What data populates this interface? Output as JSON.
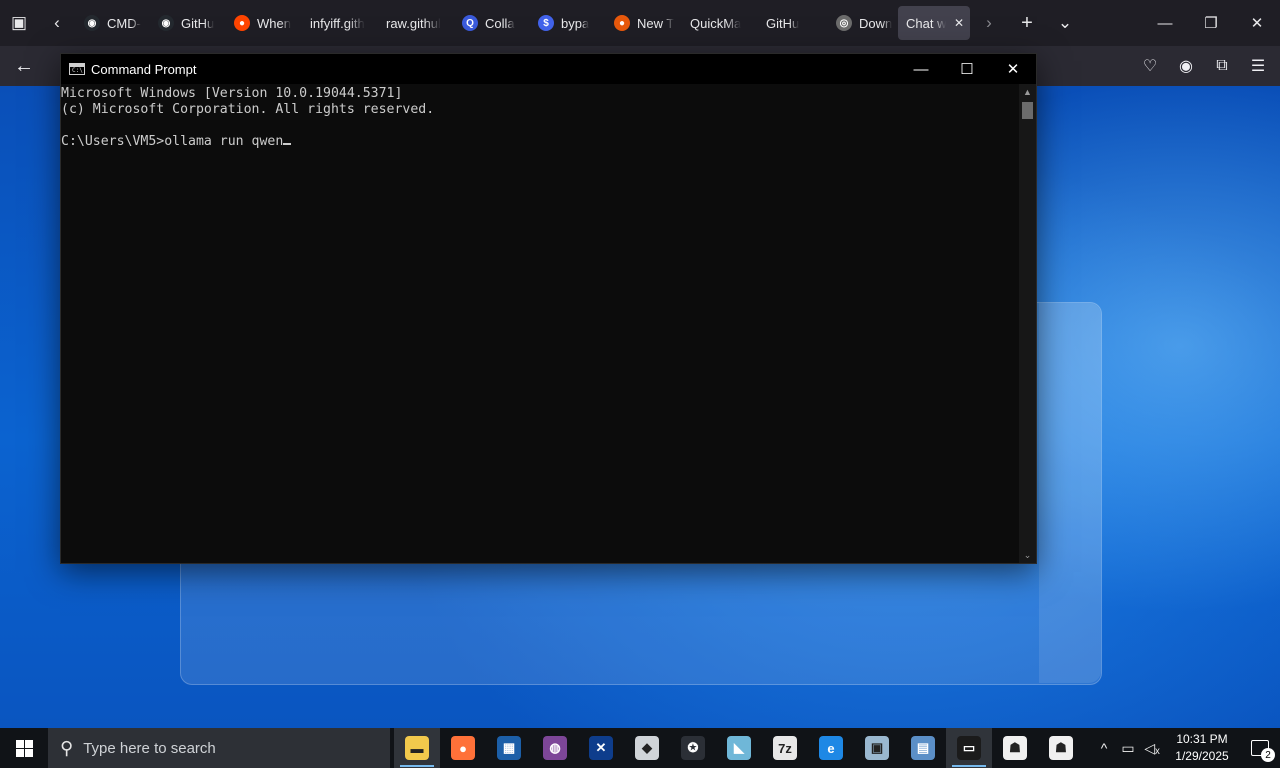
{
  "colors": {
    "browser_tabstrip": "#1f1e25",
    "browser_toolbar": "#2b2a33",
    "console_bg": "#0c0c0c",
    "console_text": "#cccccc",
    "taskbar": "#101317",
    "desktop_accent": "#0b5bc4"
  },
  "browser": {
    "tabs": [
      {
        "label": "CMD-",
        "icon": "github-icon",
        "color": "#24292f",
        "glyph": "◉"
      },
      {
        "label": "GitHu",
        "icon": "github-icon",
        "color": "#24292f",
        "glyph": "◉"
      },
      {
        "label": "When",
        "icon": "reddit-icon",
        "color": "#ff4500",
        "glyph": "●"
      },
      {
        "label": "infyiff.gith",
        "icon": "",
        "color": "",
        "glyph": ""
      },
      {
        "label": "raw.githul",
        "icon": "",
        "color": "",
        "glyph": ""
      },
      {
        "label": "Colla",
        "icon": "search-icon",
        "color": "#3b5bdb",
        "glyph": "Q"
      },
      {
        "label": "bypa",
        "icon": "dollar-icon",
        "color": "#4263eb",
        "glyph": "$"
      },
      {
        "label": "New T",
        "icon": "firefox-icon",
        "color": "#e8590c",
        "glyph": "●"
      },
      {
        "label": "QuickMa",
        "icon": "",
        "color": "",
        "glyph": ""
      },
      {
        "label": "GitHu",
        "icon": "",
        "color": "",
        "glyph": ""
      },
      {
        "label": "Down",
        "icon": "download-site-icon",
        "color": "#6c6c6c",
        "glyph": "◎"
      },
      {
        "label": "Chat w",
        "icon": "",
        "color": "",
        "glyph": "",
        "active": true
      }
    ]
  },
  "cmd": {
    "title": "Command Prompt",
    "icon_text": "C:\\",
    "lines": [
      "Microsoft Windows [Version 10.0.19044.5371]",
      "(c) Microsoft Corporation. All rights reserved.",
      "",
      "C:\\Users\\VM5>ollama run qwen"
    ]
  },
  "taskbar": {
    "search_placeholder": "Type here to search",
    "apps": [
      {
        "name": "file-explorer-icon",
        "color": "#f2c94c",
        "glyph": "▬",
        "running": true,
        "open": true
      },
      {
        "name": "firefox-icon",
        "color": "#ff7139",
        "glyph": "●",
        "running": false
      },
      {
        "name": "app-chart-icon",
        "color": "#1c5fa8",
        "glyph": "▦",
        "running": false
      },
      {
        "name": "tor-browser-icon",
        "color": "#7d4698",
        "glyph": "◍",
        "running": false
      },
      {
        "name": "visual-studio-icon",
        "color": "#0e3d8c",
        "glyph": "✕",
        "running": false
      },
      {
        "name": "roblox-icon",
        "color": "#d0d4d8",
        "glyph": "◆",
        "running": false
      },
      {
        "name": "star-app-icon",
        "color": "#2b2f36",
        "glyph": "✪",
        "running": false
      },
      {
        "name": "app-cube-icon",
        "color": "#6fb7d8",
        "glyph": "◣",
        "running": false
      },
      {
        "name": "7zip-icon",
        "color": "#e8e8e8",
        "glyph": "7z",
        "running": false
      },
      {
        "name": "edge-legacy-icon",
        "color": "#1e88e5",
        "glyph": "e",
        "running": false
      },
      {
        "name": "app-monitor-icon",
        "color": "#9ab8d0",
        "glyph": "▣",
        "running": false
      },
      {
        "name": "control-panel-icon",
        "color": "#5b8fc7",
        "glyph": "▤",
        "running": false
      },
      {
        "name": "command-prompt-icon",
        "color": "#1b1b1b",
        "glyph": "▭",
        "running": true,
        "open": true
      },
      {
        "name": "app-cat-icon",
        "color": "#f0f0f0",
        "glyph": "☗",
        "running": false
      },
      {
        "name": "app-cat2-icon",
        "color": "#f0f0f0",
        "glyph": "☗",
        "running": false
      }
    ],
    "clock_time": "10:31 PM",
    "clock_date": "1/29/2025",
    "notification_count": "2"
  }
}
